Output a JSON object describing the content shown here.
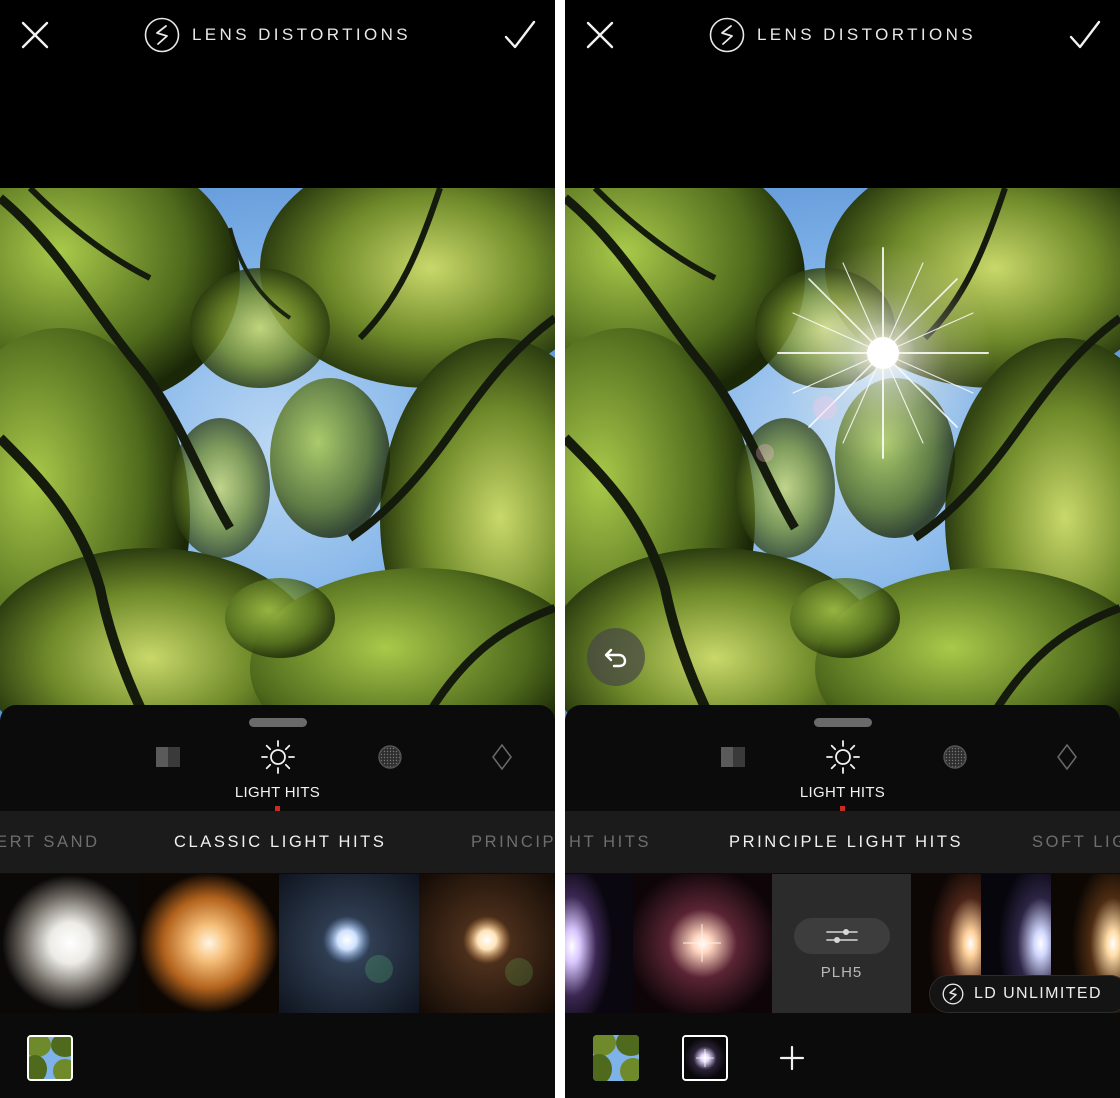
{
  "app": {
    "title": "LENS DISTORTIONS"
  },
  "left": {
    "category": {
      "active_label": "LIGHT HITS",
      "icons": [
        "split-tone-icon",
        "sun-icon",
        "texture-icon",
        "diamond-icon"
      ]
    },
    "subcategories": [
      "ERT SAND",
      "CLASSIC LIGHT HITS",
      "PRINCIPLE LIGHT HITS"
    ],
    "active_subcategory": "CLASSIC LIGHT HITS"
  },
  "right": {
    "category": {
      "active_label": "LIGHT HITS",
      "icons": [
        "split-tone-icon",
        "sun-icon",
        "texture-icon",
        "diamond-icon"
      ]
    },
    "subcategories": [
      "HT HITS",
      "PRINCIPLE LIGHT HITS",
      "SOFT LIG"
    ],
    "active_subcategory": "PRINCIPLE LIGHT HITS",
    "selected_preset": "PLH5",
    "promo_label": "LD UNLIMITED"
  },
  "colors": {
    "accent_marker": "#c62c1f",
    "panel": "#0b0b0b",
    "subcategory_bar": "#1b1b1b"
  }
}
